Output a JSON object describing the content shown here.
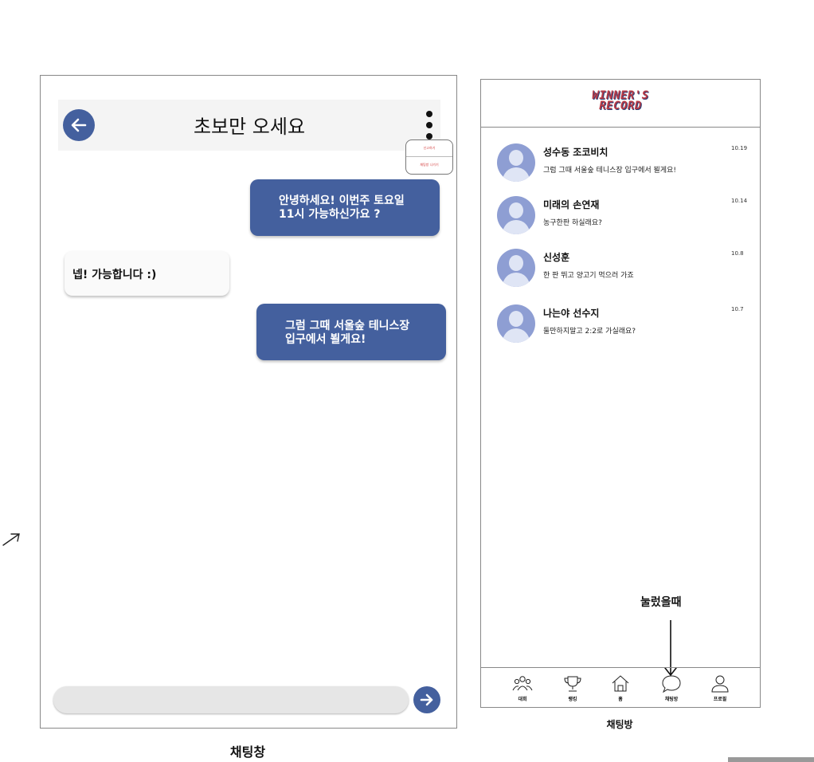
{
  "chat_room": {
    "title": "초보만 오세요",
    "menu": {
      "report": "신고하기",
      "leave": "채팅방 나가기"
    },
    "messages": [
      {
        "side": "right",
        "text": "안녕하세요! 이번주 토요일\n11시 가능하신가요 ?"
      },
      {
        "side": "left",
        "text": "넵! 가능합니다 :)"
      },
      {
        "side": "right",
        "text": "그럼 그때 서울숲 테니스장\n입구에서 뵐게요!"
      }
    ],
    "input_placeholder": "",
    "caption": "채팅창"
  },
  "chat_list": {
    "logo": {
      "line1": "WINNER'S",
      "line2": "RECORD"
    },
    "rows": [
      {
        "name": "성수동 조코비치",
        "preview": "그럼 그때 서울숲 테니스장 입구에서 뵐게요!",
        "date": "10.19"
      },
      {
        "name": "미래의 손연재",
        "preview": "농구한판 하실래요?",
        "date": "10.14"
      },
      {
        "name": "신성훈",
        "preview": "한 판 뛰고 양고기 먹으러 가죠",
        "date": "10.8"
      },
      {
        "name": "나는야 선수지",
        "preview": "둘만하지말고 2:2로 가실래요?",
        "date": "10.7"
      }
    ],
    "annotation": "눌렀을때",
    "nav": [
      {
        "icon": "people-icon",
        "label": "대회"
      },
      {
        "icon": "trophy-icon",
        "label": "랭킹"
      },
      {
        "icon": "home-icon",
        "label": "홈"
      },
      {
        "icon": "chat-bubble-icon",
        "label": "채팅방"
      },
      {
        "icon": "person-icon",
        "label": "프로필"
      }
    ],
    "caption": "채팅방"
  },
  "colors": {
    "accent": "#44609e",
    "avatar": "#8e9ed3",
    "popup_text": "#d23b3b",
    "logo_red": "#b83a46"
  }
}
